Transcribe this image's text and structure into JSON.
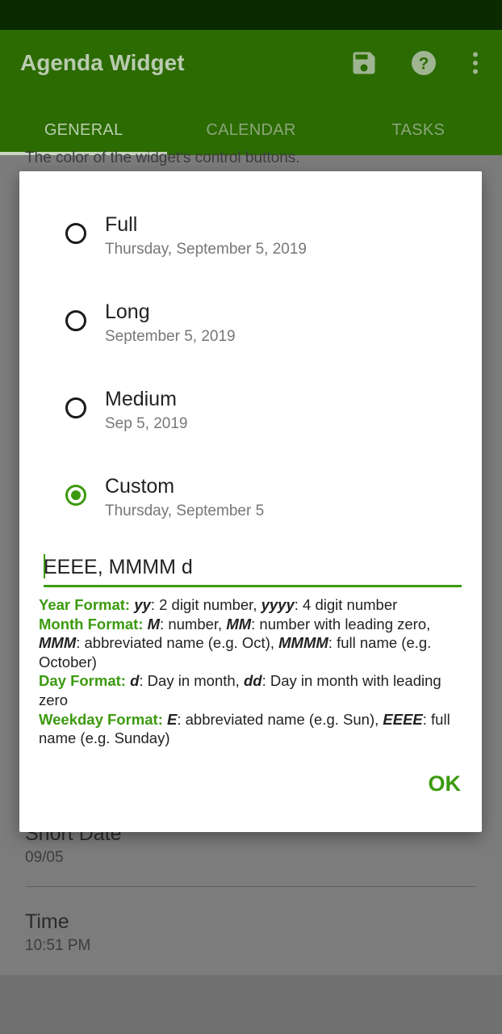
{
  "app": {
    "title": "Agenda Widget"
  },
  "toolbar": {
    "icons": [
      "save-icon",
      "help-icon",
      "more-vert-icon"
    ]
  },
  "tabs": [
    {
      "label": "GENERAL",
      "active": true
    },
    {
      "label": "CALENDAR",
      "active": false
    },
    {
      "label": "TASKS",
      "active": false
    }
  ],
  "background": {
    "partial_text": "The color of the widget's control buttons.",
    "short_date": {
      "label": "Short Date",
      "value": "09/05"
    },
    "time": {
      "label": "Time",
      "value": "10:51 PM"
    }
  },
  "dialog": {
    "options": [
      {
        "title": "Full",
        "example": "Thursday, September 5, 2019",
        "selected": false
      },
      {
        "title": "Long",
        "example": "September 5, 2019",
        "selected": false
      },
      {
        "title": "Medium",
        "example": "Sep 5, 2019",
        "selected": false
      },
      {
        "title": "Custom",
        "example": "Thursday, September 5",
        "selected": true
      }
    ],
    "custom_format_value": "EEEE, MMMM d",
    "help": {
      "year_label": "Year Format:",
      "year_yy": "yy",
      "year_yy_desc": ": 2 digit number, ",
      "year_yyyy": "yyyy",
      "year_yyyy_desc": ": 4 digit number",
      "month_label": "Month Format:",
      "month_M": "M",
      "month_M_desc": ": number, ",
      "month_MM": "MM",
      "month_MM_desc": ": number with leading zero, ",
      "month_MMM": "MMM",
      "month_MMM_desc": ": abbreviated name (e.g. Oct), ",
      "month_MMMM": "MMMM",
      "month_MMMM_desc": ": full name (e.g. October)",
      "day_label": "Day Format:",
      "day_d": "d",
      "day_d_desc": ": Day in month, ",
      "day_dd": "dd",
      "day_dd_desc": ": Day in month with leading zero",
      "weekday_label": "Weekday Format:",
      "weekday_E": "E",
      "weekday_E_desc": ": abbreviated name (e.g. Sun), ",
      "weekday_EEEE": "EEEE",
      "weekday_EEEE_desc": ": full name (e.g. Sunday)"
    },
    "ok_label": "OK"
  },
  "colors": {
    "accent": "#3c9a0f",
    "app_bar": "#3c8c04"
  }
}
